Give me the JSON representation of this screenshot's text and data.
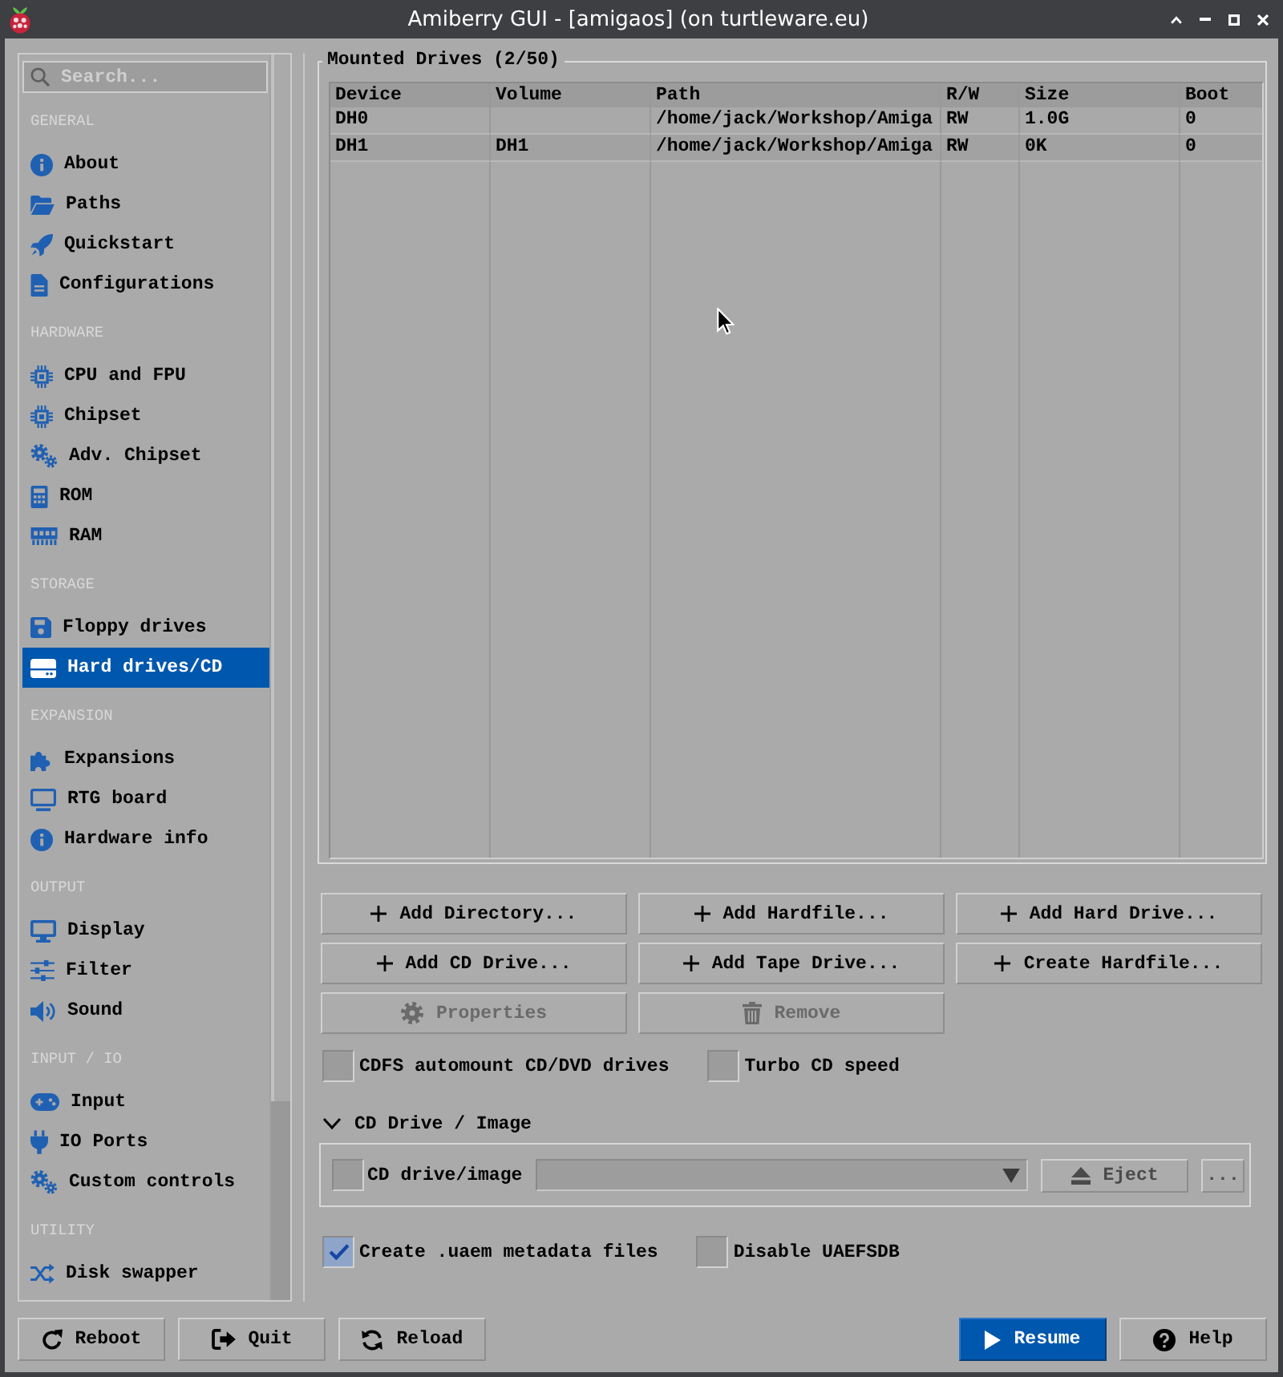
{
  "window": {
    "title": "Amiberry GUI - [amigaos] (on turtleware.eu)"
  },
  "sidebar": {
    "search": {
      "placeholder": "Search..."
    },
    "sections": [
      {
        "heading": "GENERAL",
        "items": [
          {
            "label": "About",
            "selected": false
          },
          {
            "label": "Paths",
            "selected": false
          },
          {
            "label": "Quickstart",
            "selected": false
          },
          {
            "label": "Configurations",
            "selected": false
          }
        ]
      },
      {
        "heading": "HARDWARE",
        "items": [
          {
            "label": "CPU and FPU",
            "selected": false
          },
          {
            "label": "Chipset",
            "selected": false
          },
          {
            "label": "Adv. Chipset",
            "selected": false
          },
          {
            "label": "ROM",
            "selected": false
          },
          {
            "label": "RAM",
            "selected": false
          }
        ]
      },
      {
        "heading": "STORAGE",
        "items": [
          {
            "label": "Floppy drives",
            "selected": false
          },
          {
            "label": "Hard drives/CD",
            "selected": true
          }
        ]
      },
      {
        "heading": "EXPANSION",
        "items": [
          {
            "label": "Expansions",
            "selected": false
          },
          {
            "label": "RTG board",
            "selected": false
          },
          {
            "label": "Hardware info",
            "selected": false
          }
        ]
      },
      {
        "heading": "OUTPUT",
        "items": [
          {
            "label": "Display",
            "selected": false
          },
          {
            "label": "Filter",
            "selected": false
          },
          {
            "label": "Sound",
            "selected": false
          }
        ]
      },
      {
        "heading": "INPUT / IO",
        "items": [
          {
            "label": "Input",
            "selected": false
          },
          {
            "label": "IO Ports",
            "selected": false
          },
          {
            "label": "Custom controls",
            "selected": false
          }
        ]
      },
      {
        "heading": "UTILITY",
        "items": [
          {
            "label": "Disk swapper",
            "selected": false
          }
        ]
      }
    ]
  },
  "mounted_drives": {
    "title": "Mounted Drives (2/50)",
    "columns": [
      "Device",
      "Volume",
      "Path",
      "R/W",
      "Size",
      "Boot"
    ],
    "rows": [
      [
        "DH0",
        null,
        "/home/jack/Workshop/Amiga",
        "RW",
        "1.0G",
        "0"
      ],
      [
        "DH1",
        "DH1",
        "/home/jack/Workshop/Amiga",
        "RW",
        "0K",
        "0"
      ]
    ]
  },
  "drive_buttons": [
    {
      "label": "Add Directory...",
      "disabled": false
    },
    {
      "label": "Add Hardfile...",
      "disabled": false
    },
    {
      "label": "Add Hard Drive...",
      "disabled": false
    },
    {
      "label": "Add CD Drive...",
      "disabled": false
    },
    {
      "label": "Add Tape Drive...",
      "disabled": false
    },
    {
      "label": "Create Hardfile...",
      "disabled": false
    },
    {
      "label": "Properties",
      "disabled": true
    },
    {
      "label": "Remove",
      "disabled": true
    }
  ],
  "cd_options": [
    {
      "label": "CDFS automount CD/DVD drives",
      "checked": false
    },
    {
      "label": "Turbo CD speed",
      "checked": false
    }
  ],
  "cd_drive": {
    "title": "CD Drive / Image",
    "expanded": true,
    "enable": {
      "label": "CD drive/image",
      "checked": false
    },
    "eject_button": {
      "label": "Eject",
      "disabled": true
    },
    "browse_button": {
      "label": "...",
      "disabled": true
    }
  },
  "filesystem_options": [
    {
      "label": "Create .uaem metadata files",
      "checked": true
    },
    {
      "label": "Disable UAEFSDB",
      "checked": false
    }
  ],
  "footer": {
    "left_buttons": [
      {
        "label": "Reboot",
        "primary": false
      },
      {
        "label": "Quit",
        "primary": false
      },
      {
        "label": "Reload",
        "primary": false
      }
    ],
    "right_buttons": [
      {
        "label": "Resume",
        "primary": true
      },
      {
        "label": "Help",
        "primary": false
      }
    ]
  }
}
